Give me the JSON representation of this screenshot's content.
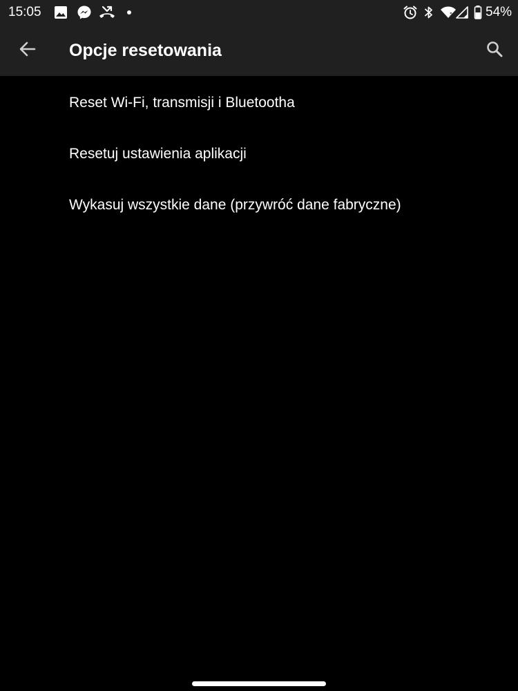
{
  "status_bar": {
    "time": "15:05",
    "battery_percent": "54%",
    "notification_icons": [
      "gallery-icon",
      "messenger-icon",
      "missed-call-icon",
      "dot-icon"
    ],
    "system_icons": [
      "alarm-icon",
      "bluetooth-icon",
      "wifi-icon",
      "cell-signal-icon",
      "battery-icon"
    ]
  },
  "app_bar": {
    "title": "Opcje resetowania",
    "back_icon": "arrow-back-icon",
    "search_icon": "search-icon"
  },
  "settings": {
    "items": [
      {
        "label": "Reset Wi-Fi, transmisji i Bluetootha"
      },
      {
        "label": "Resetuj ustawienia aplikacji"
      },
      {
        "label": "Wykasuj wszystkie dane (przywróć dane fabryczne)"
      }
    ]
  },
  "colors": {
    "background": "#000000",
    "app_bar": "#202020",
    "text": "#ffffff",
    "icon": "#d0d0d0"
  }
}
